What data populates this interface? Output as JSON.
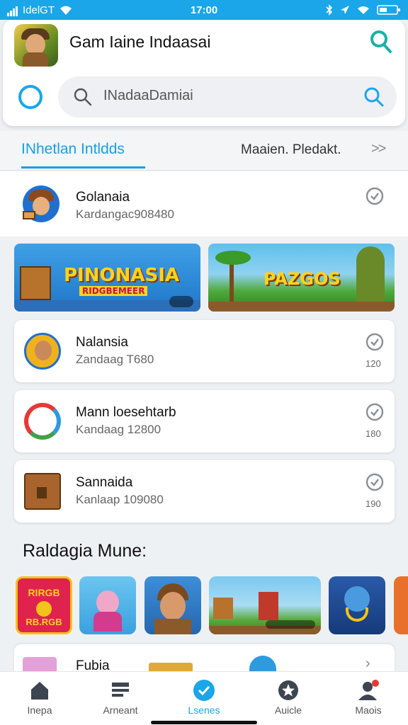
{
  "status_bar": {
    "carrier": "IdelGT",
    "time": "17:00"
  },
  "header": {
    "app_title": "Gam Iaine Indaasai",
    "search_placeholder": "INadaaDamiai"
  },
  "tabs": {
    "active": "INhetlan Intldds",
    "second": "Maaien. Pledakt.",
    "more": ">>"
  },
  "rows": [
    {
      "title": "Golanaia",
      "subtitle": "Kardangac908480"
    },
    {
      "title": "Nalansia",
      "subtitle": "Zandaag T680",
      "count": "120"
    },
    {
      "title": "Mann loesehtarb",
      "subtitle": "Kandaag 12800",
      "count": "180"
    },
    {
      "title": "Sannaida",
      "subtitle": "Kanlaap 109080",
      "count": "190"
    }
  ],
  "banners": [
    {
      "title": "PINONASIA",
      "subtitle": "RIDGBEMEER"
    },
    {
      "title": "PAZGOS"
    }
  ],
  "section": {
    "title": "Raldagia Mune:"
  },
  "thumb_badge": {
    "line1": "RIRGB",
    "line2": "RB.RGB"
  },
  "bottom_card": {
    "title": "Fubia"
  },
  "nav": [
    {
      "label": "Inepa",
      "icon": "home-icon"
    },
    {
      "label": "Arneant",
      "icon": "news-icon"
    },
    {
      "label": "Lsenes",
      "icon": "check-icon"
    },
    {
      "label": "Auicle",
      "icon": "star-icon"
    },
    {
      "label": "Maois",
      "icon": "profile-icon"
    }
  ],
  "colors": {
    "accent": "#1aa6e8",
    "active_tab": "#1a9fe0",
    "check_grey": "#8a9096"
  }
}
